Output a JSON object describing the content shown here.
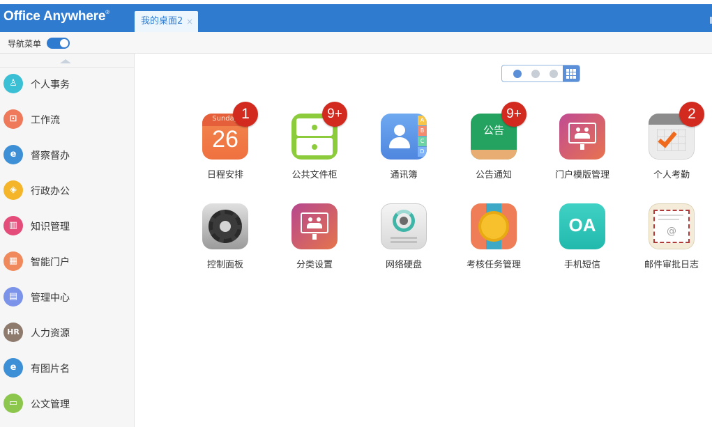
{
  "header": {
    "logo": "Office Anywhere",
    "logo_mark": "®",
    "tab_label": "我的桌面2",
    "tab_close": "×"
  },
  "nav": {
    "toggle_label": "导航菜单"
  },
  "sidebar": {
    "items": [
      {
        "label": "个人事务",
        "icon": "person-icon",
        "color": "#3bbfd4",
        "glyph": "♙"
      },
      {
        "label": "工作流",
        "icon": "workflow-icon",
        "color": "#ef7a5b",
        "glyph": "⊡"
      },
      {
        "label": "督察督办",
        "icon": "ie-icon",
        "color": "#3d8fd6",
        "glyph": "e"
      },
      {
        "label": "行政办公",
        "icon": "layers-icon",
        "color": "#f4b52b",
        "glyph": "◈"
      },
      {
        "label": "知识管理",
        "icon": "book-icon",
        "color": "#e44d7a",
        "glyph": "▥"
      },
      {
        "label": "智能门户",
        "icon": "building-icon",
        "color": "#f08a5d",
        "glyph": "▦"
      },
      {
        "label": "管理中心",
        "icon": "document-icon",
        "color": "#7b93e8",
        "glyph": "▤"
      },
      {
        "label": "人力资源",
        "icon": "hr-icon",
        "color": "#8f7a6e",
        "glyph": "HR"
      },
      {
        "label": "有图片名",
        "icon": "ie-icon",
        "color": "#3d8fd6",
        "glyph": "e"
      },
      {
        "label": "公文管理",
        "icon": "briefcase-icon",
        "color": "#8dc64c",
        "glyph": "▭"
      }
    ]
  },
  "pager": {
    "pages": 3,
    "active": 0
  },
  "apps": [
    {
      "name": "日程安排",
      "icon": "calendar-icon",
      "badge": "1",
      "cal_day": "Sunday",
      "cal_date": "26"
    },
    {
      "name": "公共文件柜",
      "icon": "file-cabinet-icon",
      "badge": "9+"
    },
    {
      "name": "通讯簿",
      "icon": "address-book-icon",
      "badge": "",
      "tabs": [
        "A",
        "B",
        "C",
        "D"
      ]
    },
    {
      "name": "公告通知",
      "icon": "notice-board-icon",
      "badge": "9+",
      "board_text": "公告"
    },
    {
      "name": "门户模版管理",
      "icon": "portal-template-icon",
      "badge": ""
    },
    {
      "name": "个人考勤",
      "icon": "attendance-icon",
      "badge": "2"
    },
    {
      "name": "控制面板",
      "icon": "gear-icon",
      "badge": ""
    },
    {
      "name": "分类设置",
      "icon": "category-icon",
      "badge": ""
    },
    {
      "name": "网络硬盘",
      "icon": "network-disk-icon",
      "badge": ""
    },
    {
      "name": "考核任务管理",
      "icon": "medal-icon",
      "badge": ""
    },
    {
      "name": "手机短信",
      "icon": "sms-icon",
      "badge": "",
      "label": "OA"
    },
    {
      "name": "邮件审批日志",
      "icon": "mail-log-icon",
      "badge": "",
      "at": "@"
    }
  ]
}
